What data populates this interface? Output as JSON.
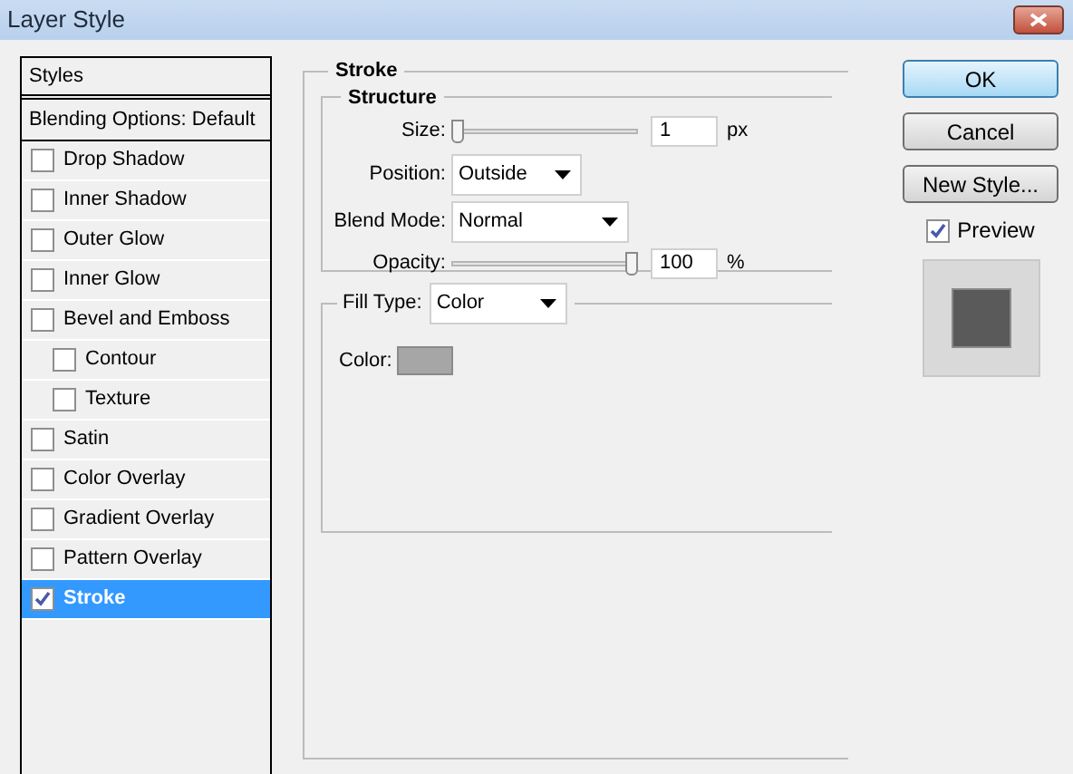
{
  "window": {
    "title": "Layer Style"
  },
  "sidebar": {
    "header": "Styles",
    "blending": {
      "label": "Blending Options: Default",
      "selected": false
    },
    "items": [
      {
        "label": "Drop Shadow",
        "checked": false,
        "selected": false
      },
      {
        "label": "Inner Shadow",
        "checked": false,
        "selected": false
      },
      {
        "label": "Outer Glow",
        "checked": false,
        "selected": false
      },
      {
        "label": "Inner Glow",
        "checked": false,
        "selected": false
      },
      {
        "label": "Bevel and Emboss",
        "checked": false,
        "selected": false,
        "children": [
          {
            "label": "Contour",
            "checked": false,
            "selected": false
          },
          {
            "label": "Texture",
            "checked": false,
            "selected": false
          }
        ]
      },
      {
        "label": "Satin",
        "checked": false,
        "selected": false
      },
      {
        "label": "Color Overlay",
        "checked": false,
        "selected": false
      },
      {
        "label": "Gradient Overlay",
        "checked": false,
        "selected": false
      },
      {
        "label": "Pattern Overlay",
        "checked": false,
        "selected": false
      },
      {
        "label": "Stroke",
        "checked": true,
        "selected": true
      }
    ]
  },
  "panel": {
    "title": "Stroke",
    "structure": {
      "title": "Structure",
      "size": {
        "label": "Size:",
        "level": 0,
        "value": "1",
        "unit": "px"
      },
      "position": {
        "label": "Position:",
        "value": "Outside"
      },
      "blend_mode": {
        "label": "Blend Mode:",
        "value": "Normal"
      },
      "opacity": {
        "label": "Opacity:",
        "level": 1,
        "value": "100",
        "unit": "%"
      }
    },
    "fill": {
      "label": "Fill Type:",
      "value": "Color",
      "color_label": "Color:",
      "color": "#a6a6a6"
    }
  },
  "buttons": [
    {
      "label": "OK",
      "default": true
    },
    {
      "label": "Cancel",
      "default": false
    },
    {
      "label": "New Style...",
      "default": false
    }
  ],
  "preview": {
    "label": "Preview",
    "checked": true
  }
}
